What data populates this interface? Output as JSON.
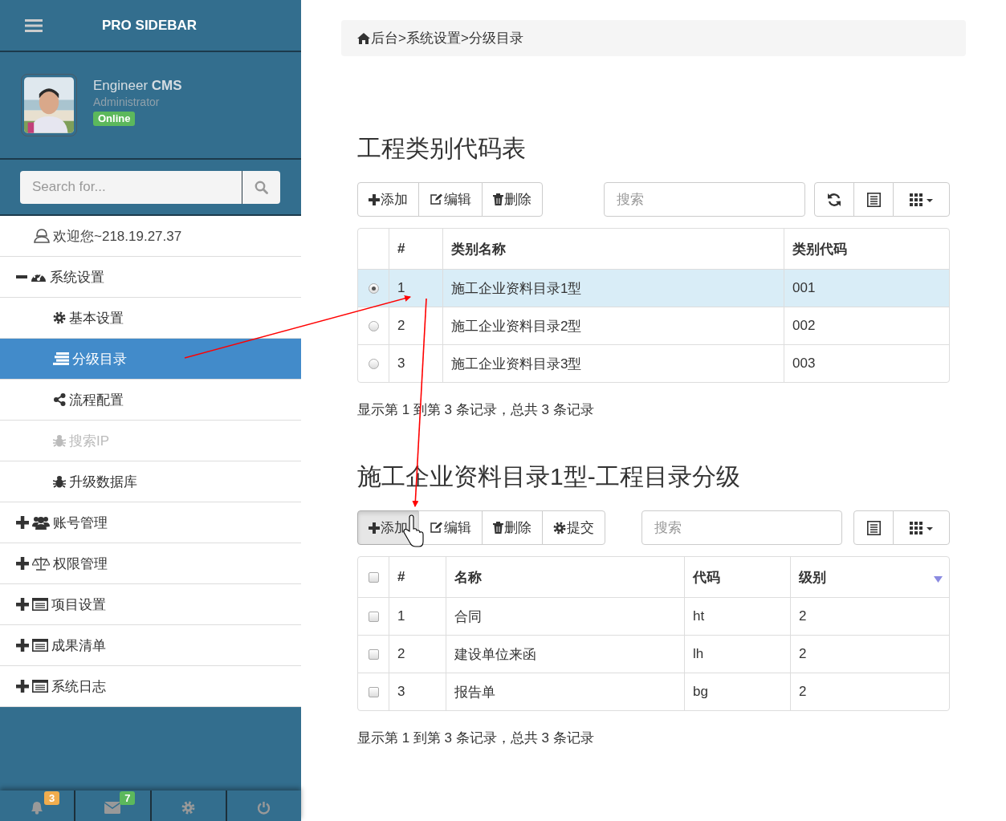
{
  "sidebar": {
    "brand": "PRO SIDEBAR",
    "user": {
      "name": "Engineer **CMS**",
      "role": "Administrator",
      "status": "Online"
    },
    "search": {
      "placeholder": "Search for..."
    },
    "menu": [
      {
        "kind": "link",
        "label": "欢迎您~218.19.27.37"
      },
      {
        "kind": "group",
        "label": "系统设置",
        "expanded": true,
        "children": [
          {
            "label": "基本设置",
            "selected": false,
            "disabled": false
          },
          {
            "label": "分级目录",
            "selected": true,
            "disabled": false
          },
          {
            "label": "流程配置",
            "selected": false,
            "disabled": false
          },
          {
            "label": "搜索IP",
            "selected": false,
            "disabled": true
          },
          {
            "label": "升级数据库",
            "selected": false,
            "disabled": false
          }
        ]
      },
      {
        "kind": "group",
        "label": "账号管理",
        "expanded": false
      },
      {
        "kind": "group",
        "label": "权限管理",
        "expanded": false
      },
      {
        "kind": "group",
        "label": "项目设置",
        "expanded": false
      },
      {
        "kind": "group",
        "label": "成果清单",
        "expanded": false
      },
      {
        "kind": "group",
        "label": "系统日志",
        "expanded": false
      }
    ],
    "footer": [
      {
        "kind": "notifications",
        "badge": "3",
        "color": "#f0ad4e"
      },
      {
        "kind": "messages",
        "badge": "7",
        "color": "#5cb85c"
      },
      {
        "kind": "settings"
      },
      {
        "kind": "power"
      }
    ]
  },
  "breadcrumb": "后台>系统设置>分级目录",
  "tables": [
    {
      "title": "工程类别代码表",
      "toolbar": [
        {
          "label": "添加",
          "active": false
        },
        {
          "label": "编辑",
          "active": false
        },
        {
          "label": "删除",
          "active": false
        }
      ],
      "search": {
        "placeholder": "搜索"
      },
      "tools": [
        {
          "kind": "refresh"
        },
        {
          "kind": "toggle"
        },
        {
          "kind": "columns"
        }
      ],
      "columns": [
        {
          "label": "#",
          "sorted": false
        },
        {
          "label": "类别名称",
          "sorted": false
        },
        {
          "label": "类别代码",
          "sorted": false
        }
      ],
      "rows": [
        {
          "cells": [
            "1",
            "施工企业资料目录1型",
            "001"
          ],
          "selected": true
        },
        {
          "cells": [
            "2",
            "施工企业资料目录2型",
            "002"
          ],
          "selected": false
        },
        {
          "cells": [
            "3",
            "施工企业资料目录3型",
            "003"
          ],
          "selected": false
        }
      ],
      "summary": "显示第 1 到第 3 条记录，总共 3 条记录"
    },
    {
      "title": "施工企业资料目录1型-工程目录分级",
      "header_checked": false,
      "toolbar": [
        {
          "label": "添加",
          "active": true
        },
        {
          "label": "编辑",
          "active": false
        },
        {
          "label": "删除",
          "active": false
        },
        {
          "label": "提交",
          "active": false
        }
      ],
      "search": {
        "placeholder": "搜索"
      },
      "tools": [
        {
          "kind": "toggle"
        },
        {
          "kind": "columns"
        }
      ],
      "columns": [
        {
          "label": "#",
          "sorted": false
        },
        {
          "label": "名称",
          "sorted": false
        },
        {
          "label": "代码",
          "sorted": false
        },
        {
          "label": "级别",
          "sorted": true
        }
      ],
      "rows": [
        {
          "cells": [
            "1",
            "合同",
            "ht",
            "2"
          ],
          "checked": false
        },
        {
          "cells": [
            "2",
            "建设单位来函",
            "lh",
            "2"
          ],
          "checked": false
        },
        {
          "cells": [
            "3",
            "报告单",
            "bg",
            "2"
          ],
          "checked": false
        }
      ],
      "summary": "显示第 1 到第 3 条记录，总共 3 条记录"
    }
  ]
}
